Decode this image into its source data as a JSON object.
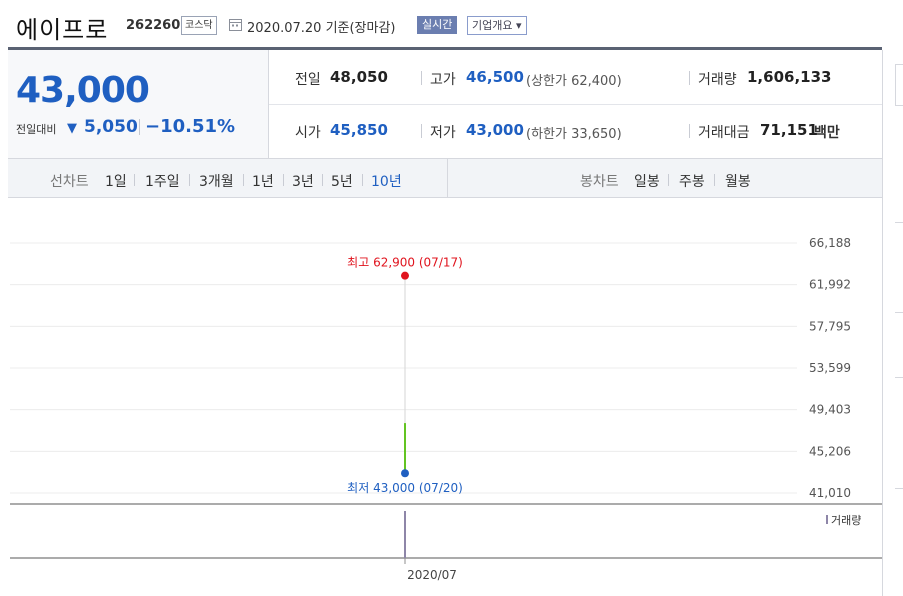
{
  "header": {
    "name": "에이프로",
    "code": "262260",
    "market": "코스닥",
    "date_text": "2020.07.20  기준(장마감)",
    "realtime": "실시간",
    "company_info": "기업개요 ▾"
  },
  "quote": {
    "price": "43,000",
    "change_label": "전일대비",
    "change_arrow": "▼",
    "change": "5,050",
    "change_pct": "−10.51%",
    "prev_label": "전일",
    "prev": "48,050",
    "high_label": "고가",
    "high": "46,500",
    "upper_limit": "(상한가 62,400)",
    "volume_label": "거래량",
    "volume": "1,606,133",
    "open_label": "시가",
    "open": "45,850",
    "low_label": "저가",
    "low": "43,000",
    "lower_limit": "(하한가 33,650)",
    "amount_label": "거래대금",
    "amount": "71,151",
    "amount_unit": "백만"
  },
  "range_tabs": {
    "line_label": "선차트",
    "items": [
      "1일",
      "1주일",
      "3개월",
      "1년",
      "3년",
      "5년",
      "10년"
    ],
    "active": "10년",
    "candle_label": "봉차트",
    "candle_items": [
      "일봉",
      "주봉",
      "월봉"
    ]
  },
  "colors": {
    "accent": "#1f5fc1",
    "high_marker": "#e0141e",
    "low_marker": "#1f5fc1",
    "line": "#63c422"
  },
  "chart_data": {
    "type": "line",
    "y_ticks": [
      "66,188",
      "61,992",
      "57,795",
      "53,599",
      "49,403",
      "45,206",
      "41,010"
    ],
    "y_tick_values": [
      66188,
      61992,
      57795,
      53599,
      49403,
      45206,
      41010
    ],
    "ylim": [
      41010,
      66188
    ],
    "x_tick": "2020/07",
    "price_line": [
      {
        "y": 48050
      },
      {
        "y": 43000
      }
    ],
    "max_label": "최고 62,900 (07/17)",
    "max_value": 62900,
    "min_label": "최저 43,000 (07/20)",
    "min_value": 43000,
    "volume_legend": "거래량",
    "grid": true
  }
}
